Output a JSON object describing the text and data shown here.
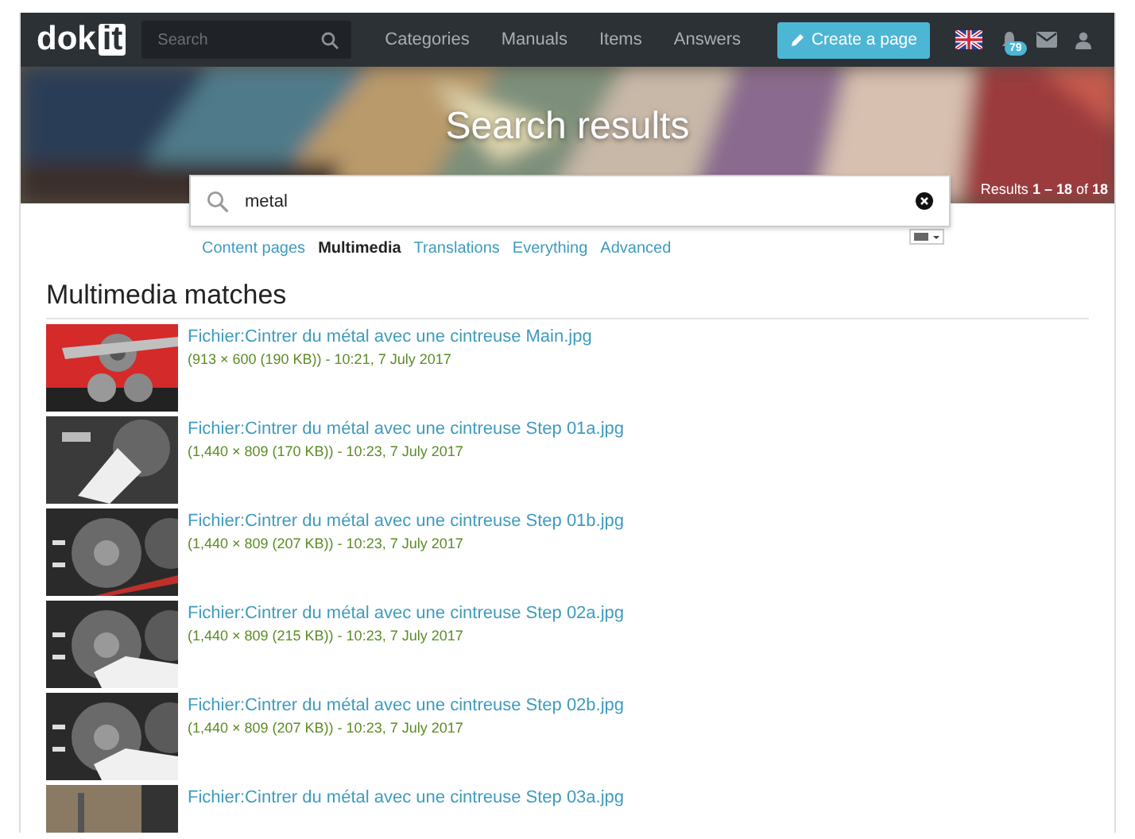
{
  "navbar": {
    "logo": {
      "part1": "dok",
      "part2": "it"
    },
    "search": {
      "placeholder": "Search"
    },
    "links": [
      "Categories",
      "Manuals",
      "Items",
      "Answers"
    ],
    "create_button": "Create a page",
    "notifications": {
      "count": "79"
    }
  },
  "banner": {
    "title": "Search results",
    "results": "Results **1 – 18** of **18**"
  },
  "search": {
    "value": "metal"
  },
  "tabs": [
    {
      "label": "Content pages",
      "selected": false
    },
    {
      "label": "Multimedia",
      "selected": true
    },
    {
      "label": "Translations",
      "selected": false
    },
    {
      "label": "Everything",
      "selected": false
    },
    {
      "label": "Advanced",
      "selected": false
    }
  ],
  "section_title": "Multimedia matches",
  "results": [
    {
      "title": "Fichier:Cintrer du métal avec une cintreuse Main.jpg",
      "meta": "(913 × 600 (190 KB)) - 10:21, 7 July 2017"
    },
    {
      "title": "Fichier:Cintrer du métal avec une cintreuse Step 01a.jpg",
      "meta": "(1,440 × 809 (170 KB)) - 10:23, 7 July 2017"
    },
    {
      "title": "Fichier:Cintrer du métal avec une cintreuse Step 01b.jpg",
      "meta": "(1,440 × 809 (207 KB)) - 10:23, 7 July 2017"
    },
    {
      "title": "Fichier:Cintrer du métal avec une cintreuse Step 02a.jpg",
      "meta": "(1,440 × 809 (215 KB)) - 10:23, 7 July 2017"
    },
    {
      "title": "Fichier:Cintrer du métal avec une cintreuse Step 02b.jpg",
      "meta": "(1,440 × 809 (207 KB)) - 10:23, 7 July 2017"
    },
    {
      "title": "Fichier:Cintrer du métal avec une cintreuse Step 03a.jpg"
    }
  ]
}
